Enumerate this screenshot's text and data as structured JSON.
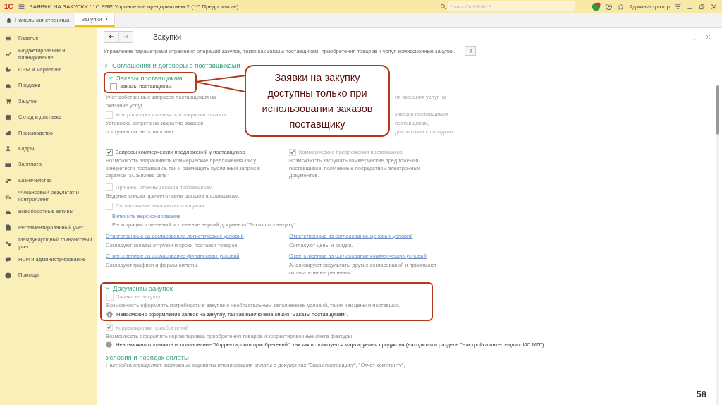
{
  "titlebar": {
    "logo": "1С",
    "title": "ЗАЯВКИ НА ЗАКУПКУ / 1С:ERP Управление предприятием 2  (1С:Предприятие)",
    "search": {
      "placeholder": "Поиск Ctrl+Shift+F"
    },
    "user": "Администратор"
  },
  "tabs": [
    {
      "label": "Начальная страница",
      "kind": "home",
      "selected": false
    },
    {
      "label": "Закупки",
      "kind": "page",
      "selected": true,
      "close": "×"
    }
  ],
  "sidebar": {
    "items": [
      {
        "label": "Главное"
      },
      {
        "label": "Бюджетирование и планирование"
      },
      {
        "label": "CRM и маркетинг"
      },
      {
        "label": "Продажи"
      },
      {
        "label": "Закупки"
      },
      {
        "label": "Склад и доставка"
      },
      {
        "label": "Производство"
      },
      {
        "label": "Кадры"
      },
      {
        "label": "Зарплата"
      },
      {
        "label": "Казначейство"
      },
      {
        "label": "Финансовый результат и контроллинг"
      },
      {
        "label": "Внеоборотные активы"
      },
      {
        "label": "Регламентированный учет"
      },
      {
        "label": "Международный финансовый учет"
      },
      {
        "label": "НСИ и администрирование"
      },
      {
        "label": "Помощь"
      }
    ]
  },
  "page": {
    "title": "Закупки",
    "description": "Управление параметрами отражения операций закупок, таких как заказы поставщикам, приобретения товаров и услуг, комиссионные закупки.",
    "help": "?",
    "agreements_section": {
      "title": "Соглашения и договоры с поставщиками",
      "expanded": false
    },
    "orders_section": {
      "title": "Заказы поставщикам",
      "expanded": true,
      "framed_option": {
        "label": "Заказы поставщикам",
        "checked": false,
        "disabled": false
      },
      "beside_callout": [
        {
          "left": {
            "kind": "text",
            "text": "Учет собственных запросов поставщикам на"
          },
          "right": {
            "kind": "text",
            "text": "ия оказания услуг на"
          }
        },
        {
          "left": {
            "kind": "text",
            "text": "оказание услуг"
          }
        },
        {
          "left": {
            "kind": "checkbox",
            "label": "Контроль поступления при закрытии заказов",
            "checked": false,
            "disabled": true
          },
          "right": {
            "kind": "text",
            "text": "заказов поставщикам"
          }
        },
        {
          "left": {
            "kind": "text",
            "text": "Установка запрета на закрытие заказов"
          },
          "right": {
            "kind": "text",
            "text": "поставщикам,"
          }
        },
        {
          "left": {
            "kind": "text",
            "text": "поступивших не полностью."
          },
          "right": {
            "kind": "text",
            "text": "для заказов с порядком"
          }
        }
      ],
      "two_columns": [
        [
          {
            "kind": "checkbox",
            "label": "Запросы коммерческих предложений у поставщиков",
            "checked": true,
            "disabled": false
          },
          {
            "kind": "text",
            "text": "Возможность запрашивать коммерческие предложения как у конкретного поставщика, так и размещать публичный запрос в сервисе \"1С:Бизнес-сеть\""
          }
        ],
        [
          {
            "kind": "checkbox",
            "label": "Коммерческие предложения поставщиков",
            "checked": true,
            "disabled": true
          },
          {
            "kind": "text",
            "text": "Возможность загружать коммерческие предложения поставщиков, полученные посредством электронных документов."
          }
        ]
      ],
      "items": [
        {
          "kind": "checkbox",
          "label": "Причины отмены заказов поставщикам",
          "checked": false,
          "disabled": true
        },
        {
          "kind": "text",
          "text": "Ведение списка причин отмены заказов поставщикам."
        },
        {
          "kind": "checkbox",
          "label": "Согласование заказов поставщикам",
          "checked": false,
          "disabled": true
        },
        {
          "kind": "sublink",
          "text": "Включить версионирование"
        },
        {
          "kind": "subtext",
          "text": "Регистрация изменений и хранение версий документа \"Заказ поставщику\"."
        }
      ],
      "links": [
        {
          "link": "Ответственные за согласование логистических условий",
          "text": "Согласуют склады отгрузки и сроки поставки товаров."
        },
        {
          "link": "Ответственные за согласование ценовых условий",
          "text": "Согласуют цены и скидки."
        },
        {
          "link": "Ответственные за согласование финансовых условий",
          "text": "Согласуют графики и формы оплаты."
        },
        {
          "link": "Ответственные за согласование коммерческих условий",
          "text": "Анализируют результаты других согласований и принимают окончательные решения."
        }
      ]
    },
    "documents_section": {
      "title": "Документы закупок",
      "expanded": true,
      "framed_items": [
        {
          "kind": "checkbox",
          "label": "Заявка на закупку",
          "checked": false,
          "disabled": true
        },
        {
          "kind": "text",
          "text": "Возможность оформлять потребности в закупке с необязательным заполнением условий, таких как цены и поставщик."
        },
        {
          "kind": "note",
          "text": "Невозможно оформление заявок на закупку, так как выключена опция \"Заказы поставщикам\"."
        }
      ],
      "items": [
        {
          "kind": "checkbox",
          "label": "Корректировки приобретений",
          "checked": true,
          "disabled": true
        },
        {
          "kind": "text",
          "text": "Возможность оформлять корректировка приобретения товаров и корректировочные счета-фактуры."
        },
        {
          "kind": "note",
          "text": "Невозможно отключить использование \"Корректировки приобретений\", так как используется маркируемая продукция (находится в разделе \"Настройка интеграции с ИС МП\")"
        }
      ]
    },
    "payment_section": {
      "title": "Условия и порядок оплаты",
      "text": "Настройка определяет возможные варианты планирования оплаты в документах \"Заказ поставщику\", \"Отчет комитенту\","
    }
  },
  "callout": {
    "text": "Заявки на закупку доступны только при использовании заказов поставщику"
  },
  "slide_number": "58"
}
